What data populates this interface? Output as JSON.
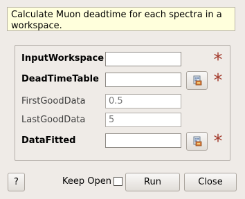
{
  "description": "Calculate Muon deadtime for each spectra in a workspace.",
  "properties": [
    {
      "label": "InputWorkspace",
      "value": "",
      "placeholder": "",
      "style": "bold",
      "browse": false,
      "required": true
    },
    {
      "label": "DeadTimeTable",
      "value": "",
      "placeholder": "",
      "style": "bold",
      "browse": true,
      "required": true
    },
    {
      "label": "FirstGoodData",
      "value": "",
      "placeholder": "0.5",
      "style": "light",
      "browse": false,
      "required": false
    },
    {
      "label": "LastGoodData",
      "value": "",
      "placeholder": "5",
      "style": "light",
      "browse": false,
      "required": false
    },
    {
      "label": "DataFitted",
      "value": "",
      "placeholder": "",
      "style": "bold",
      "browse": true,
      "required": true
    }
  ],
  "required_marker": "*",
  "buttons": {
    "help": "?",
    "keep_open": "Keep Open",
    "keep_open_checked": false,
    "run": "Run",
    "close": "Close"
  },
  "icons": {
    "browse": "workspace-browse-icon",
    "required": "required-asterisk-icon"
  },
  "colors": {
    "required": "#a33a2c",
    "description_bg": "#ffffdc",
    "window_bg": "#efebe7"
  }
}
